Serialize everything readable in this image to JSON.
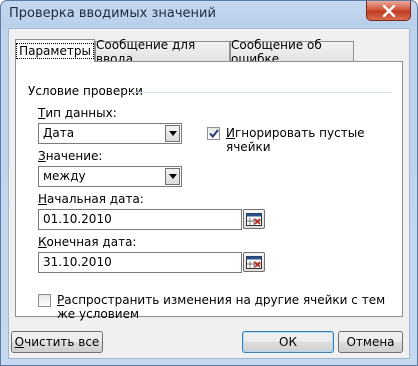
{
  "window": {
    "title": "Проверка вводимых значений"
  },
  "tabs": [
    {
      "label": "Параметры",
      "active": true
    },
    {
      "label": "Сообщение для ввода",
      "active": false
    },
    {
      "label": "Сообщение об ошибке",
      "active": false
    }
  ],
  "group": {
    "label": "Условие проверки"
  },
  "data_type": {
    "label": "Тип данных:",
    "underline": "Т",
    "rest": "ип данных:",
    "value": "Дата"
  },
  "ignore_blank": {
    "label": "Игнорировать пустые ячейки",
    "underline": "И",
    "rest": "гнорировать пустые ячейки",
    "checked": true
  },
  "operator": {
    "label": "Значение:",
    "underline": "З",
    "rest": "начение:",
    "value": "между"
  },
  "start_date": {
    "label": "Начальная дата:",
    "underline": "Н",
    "rest": "ачальная дата:",
    "value": "01.10.2010"
  },
  "end_date": {
    "label": "Конечная дата:",
    "underline": "К",
    "rest": "онечная дата:",
    "value": "31.10.2010"
  },
  "apply_all": {
    "label": "Распространить изменения на другие ячейки с тем же условием",
    "underline": "Р",
    "rest": "аспространить изменения на другие ячейки с тем же условием",
    "checked": false
  },
  "buttons": {
    "clear": "Очистить все",
    "clear_underline": "О",
    "clear_rest": "чистить все",
    "ok": "ОК",
    "cancel": "Отмена"
  },
  "icons": {
    "close": "close-icon",
    "dropdown": "chevron-down-icon",
    "range": "range-select-icon",
    "check": "checkmark-icon"
  }
}
